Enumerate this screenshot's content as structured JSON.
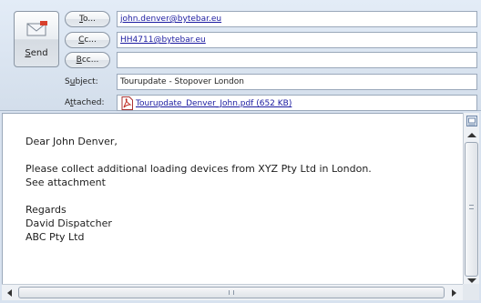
{
  "compose": {
    "send": {
      "key": "S",
      "rest": "end",
      "icon": "send-mail-icon"
    },
    "to": {
      "button_key": "T",
      "button_rest": "o...",
      "value": "john.denver@bytebar.eu"
    },
    "cc": {
      "button_key": "C",
      "button_rest": "c...",
      "value": "HH4711@bytebar.eu"
    },
    "bcc": {
      "button_key": "B",
      "button_rest": "cc...",
      "value": ""
    },
    "subject": {
      "label_pre": "S",
      "label_key": "u",
      "label_post": "bject:",
      "value": "Tourupdate - Stopover London"
    },
    "attached": {
      "label_pre": "A",
      "label_key": "t",
      "label_post": "tached:",
      "file": "Tourupdate_Denver_John.pdf (652 KB)",
      "icon": "pdf-icon"
    }
  },
  "body": {
    "lines": [
      "Dear John Denver,",
      "",
      "Please collect additional loading devices from XYZ Pty Ltd in London.",
      "See attachment",
      "",
      "Regards",
      "David Dispatcher",
      "ABC Pty Ltd"
    ]
  },
  "colors": {
    "link": "#1a1aa0",
    "header_bg": "#d8e2ef"
  }
}
